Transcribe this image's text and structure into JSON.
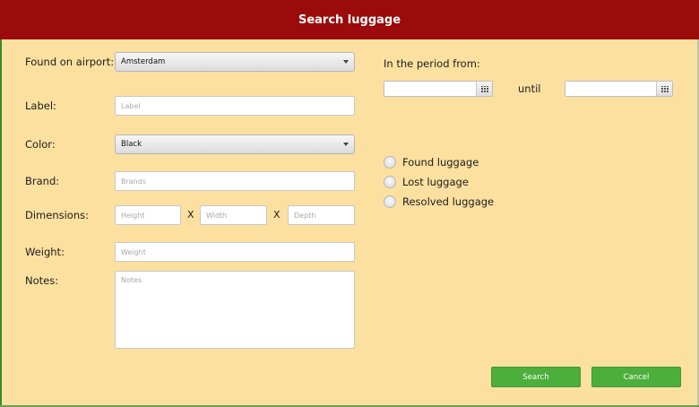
{
  "window": {
    "title": "Search luggage"
  },
  "form": {
    "airport": {
      "label": "Found on airport:",
      "value": "Amsterdam"
    },
    "label": {
      "label": "Label:",
      "placeholder": "Label"
    },
    "color": {
      "label": "Color:",
      "value": "Black"
    },
    "brand": {
      "label": "Brand:",
      "placeholder": "Brands"
    },
    "dimensions": {
      "label": "Dimensions:",
      "height_placeholder": "Height",
      "width_placeholder": "Width",
      "depth_placeholder": "Depth",
      "separator": "X"
    },
    "weight": {
      "label": "Weight:",
      "placeholder": "Weight"
    },
    "notes": {
      "label": "Notes:",
      "placeholder": "Notes"
    }
  },
  "period": {
    "label": "In the period from:",
    "from_value": "",
    "until_label": "until",
    "until_value": ""
  },
  "status_options": [
    {
      "label": "Found luggage",
      "selected": false
    },
    {
      "label": "Lost luggage",
      "selected": false
    },
    {
      "label": "Resolved luggage",
      "selected": false
    }
  ],
  "buttons": {
    "search": "Search",
    "cancel": "Cancel"
  },
  "colors": {
    "titlebar": "#9b0b0b",
    "background": "#fce0a0",
    "button": "#4caf3c"
  }
}
